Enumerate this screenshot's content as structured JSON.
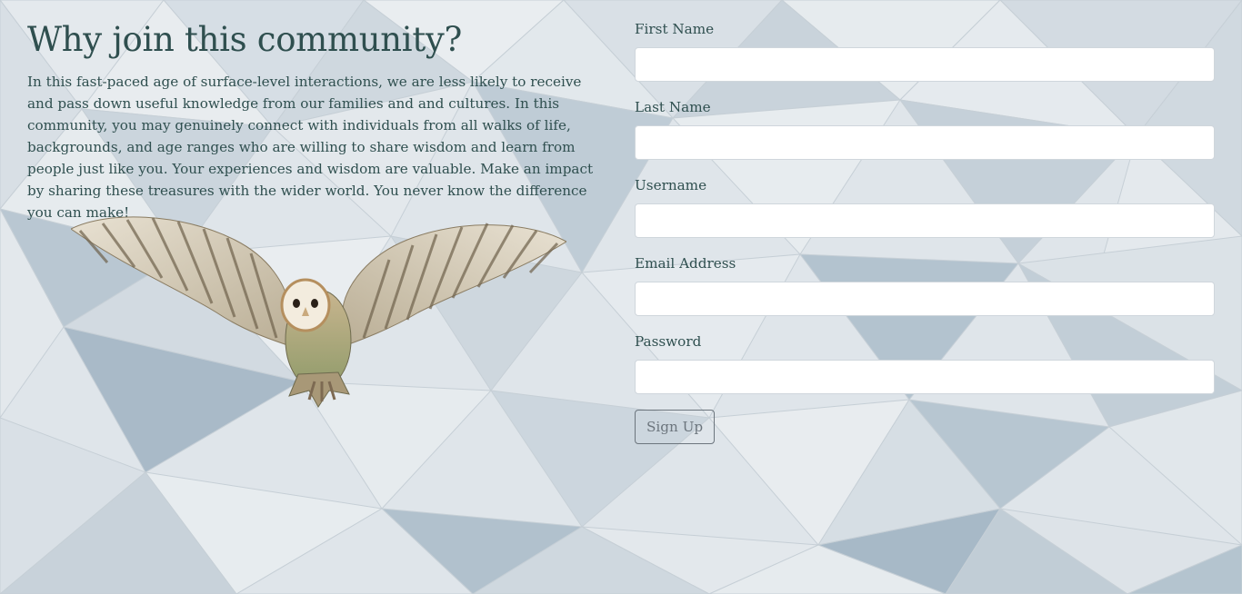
{
  "hero": {
    "title": "Why join this community?",
    "body": "In this fast-paced age of surface-level interactions, we are less likely to receive and pass down useful knowledge from our families and and cultures. In this community, you may genuinely connect with individuals from all walks of life, backgrounds, and age ranges who are willing to share wisdom and learn from people just like you. Your experiences and wisdom are valuable. Make an impact by sharing these treasures with the wider world. You never know the difference you can make!"
  },
  "form": {
    "fields": {
      "first_name": {
        "label": "First Name",
        "value": ""
      },
      "last_name": {
        "label": "Last Name",
        "value": ""
      },
      "username": {
        "label": "Username",
        "value": ""
      },
      "email": {
        "label": "Email Address",
        "value": ""
      },
      "password": {
        "label": "Password",
        "value": ""
      }
    },
    "submit_label": "Sign Up"
  },
  "colors": {
    "text": "#2f4f4f",
    "button_outline": "#6c757d",
    "background": "#dde3e8"
  },
  "images": {
    "background": "low-poly-geometric-pattern",
    "hero_image": "barn-owl-flying"
  }
}
